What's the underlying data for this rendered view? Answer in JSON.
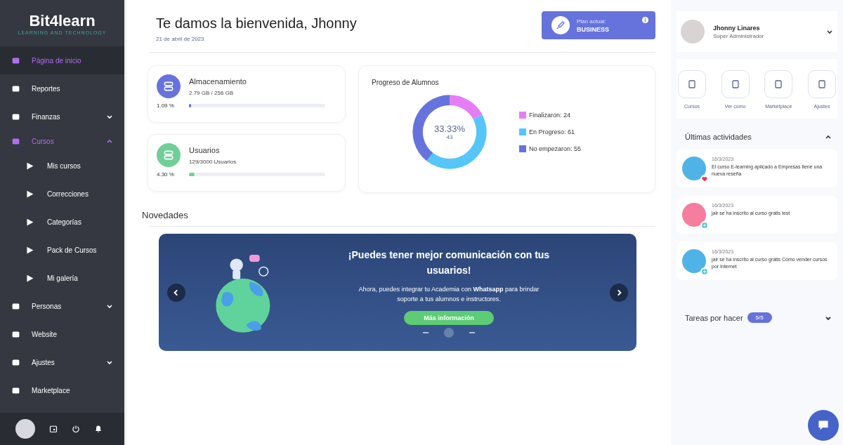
{
  "sidebar": {
    "logo": "Bit4learn",
    "logo_tagline": "LEARNING AND TECHNOLOGY",
    "items": [
      {
        "label": "Página de inicio",
        "selected": true
      },
      {
        "label": "Reportes",
        "selected": false
      },
      {
        "label": "Finanzas",
        "selected": false,
        "expanded": false
      },
      {
        "label": "Cursos",
        "selected": false,
        "expanded": true,
        "children": [
          {
            "label": "Mis cursos",
            "selected": false
          },
          {
            "label": "Correcciones",
            "selected": false
          },
          {
            "label": "Categorías",
            "selected": false
          },
          {
            "label": "Pack de Cursos",
            "selected": false
          },
          {
            "label": "Mi galería",
            "selected": false
          }
        ]
      },
      {
        "label": "Personas",
        "selected": false,
        "expanded": false
      },
      {
        "label": "Website",
        "selected": false
      },
      {
        "label": "Ajustes",
        "selected": false,
        "expanded": false
      },
      {
        "label": "Marketplace",
        "selected": false
      }
    ]
  },
  "header": {
    "title": "Te damos la bienvenida, Jhonny",
    "date": "21 de abril de 2023",
    "plan_label": "Plan actual:",
    "plan_name": "BUSINESS"
  },
  "stats": [
    {
      "title": "Almacenamiento",
      "detail": "2.79 GB / 256 GB",
      "percent": "1.09 %",
      "level": 0.0109,
      "color": "#6673dd"
    },
    {
      "title": "Usuarios",
      "detail": "129/3000 Usuarios",
      "percent": "4.30 %",
      "level": 0.043,
      "color": "#6fcf97"
    }
  ],
  "progress": {
    "title": "Progreso de Alumnos",
    "center_value": "33.33%",
    "center_count": "43",
    "chart_data": {
      "type": "donut",
      "categories": [
        "Finalizaron: 24",
        "En Progreso: 61",
        "No empezaron: 55"
      ],
      "values": [
        24,
        61,
        55
      ],
      "colors": [
        "#e57ef5",
        "#55c6f7",
        "#6673dd"
      ]
    }
  },
  "news": {
    "title": "Novedades",
    "banner": {
      "heading": "¡Puedes tener mejor comunicación con tus usuarios!",
      "text": "Ahora, puedes integrar tu Academia con **Whatsapp** para brindar soporte a tus alumnos e instructores.",
      "button": "Más información"
    },
    "dots": [
      {
        "selected": false
      },
      {
        "selected": true
      },
      {
        "selected": false
      }
    ]
  },
  "profile": {
    "name": "Jhonny Linares",
    "role": "Súper Administrador"
  },
  "shortcuts": [
    {
      "label": "Cursos"
    },
    {
      "label": "Ver como"
    },
    {
      "label": "Marketplace"
    },
    {
      "label": "Ajustes"
    }
  ],
  "activities": {
    "title": "Últimas actividades",
    "expanded": true,
    "items": [
      {
        "date": "16/3/2023",
        "text": "El curso E-learning aplicado a Empresas tiene una nueva reseña",
        "kind": "review",
        "color": "#4fb3e8"
      },
      {
        "date": "16/3/2023",
        "text": "jair se ha inscrito al curso gratis test",
        "kind": "enrollment",
        "color": "#f57d9e"
      },
      {
        "date": "16/3/2023",
        "text": "jair se ha inscrito al curso gratis Cómo vender cursos por Internet",
        "kind": "enrollment",
        "color": "#4fb3e8"
      }
    ]
  },
  "tasks": {
    "title": "Tareas por hacer",
    "count": "5/5",
    "expanded": false
  }
}
